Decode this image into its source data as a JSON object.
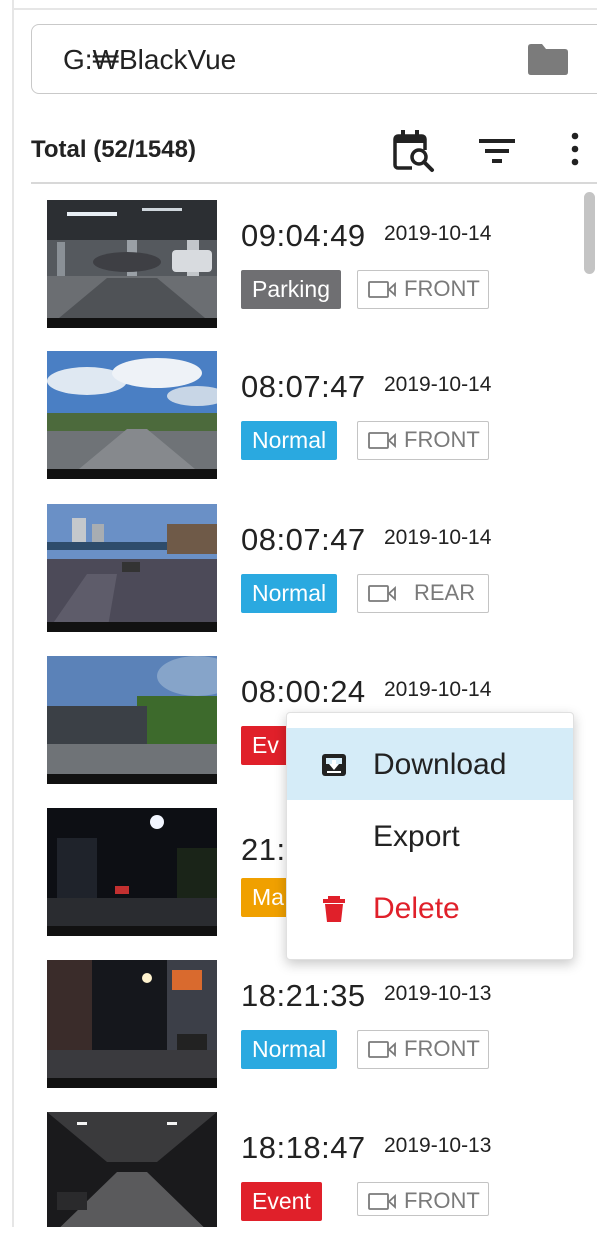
{
  "path_bar": {
    "path": "G:₩BlackVue",
    "icon": "folder-icon"
  },
  "toolbar": {
    "title": "Total (52/1548)",
    "icons": [
      "calendar-search-icon",
      "filter-icon",
      "more-vert-icon"
    ]
  },
  "recordings": [
    {
      "time": "09:04:49",
      "date": "2019-10-14",
      "type": "Parking",
      "camera": "FRONT"
    },
    {
      "time": "08:07:47",
      "date": "2019-10-14",
      "type": "Normal",
      "camera": "FRONT"
    },
    {
      "time": "08:07:47",
      "date": "2019-10-14",
      "type": "Normal",
      "camera": "REAR"
    },
    {
      "time": "08:00:24",
      "date": "2019-10-14",
      "type": "Ev",
      "camera": ""
    },
    {
      "time": "21:",
      "date": "",
      "type": "Ma",
      "camera": ""
    },
    {
      "time": "18:21:35",
      "date": "2019-10-13",
      "type": "Normal",
      "camera": "FRONT"
    },
    {
      "time": "18:18:47",
      "date": "2019-10-13",
      "type": "Event",
      "camera": "FRONT"
    }
  ],
  "context_menu": {
    "items": [
      {
        "label": "Download",
        "icon": "download-icon",
        "active": true
      },
      {
        "label": "Export",
        "icon": ""
      },
      {
        "label": "Delete",
        "icon": "trash-icon",
        "color": "#e0202a"
      }
    ]
  },
  "colors": {
    "parking": "#6f6f72",
    "normal": "#2aa9e0",
    "event": "#e0202a",
    "manual": "#f0a000",
    "menu_active": "#d5ecf8"
  }
}
